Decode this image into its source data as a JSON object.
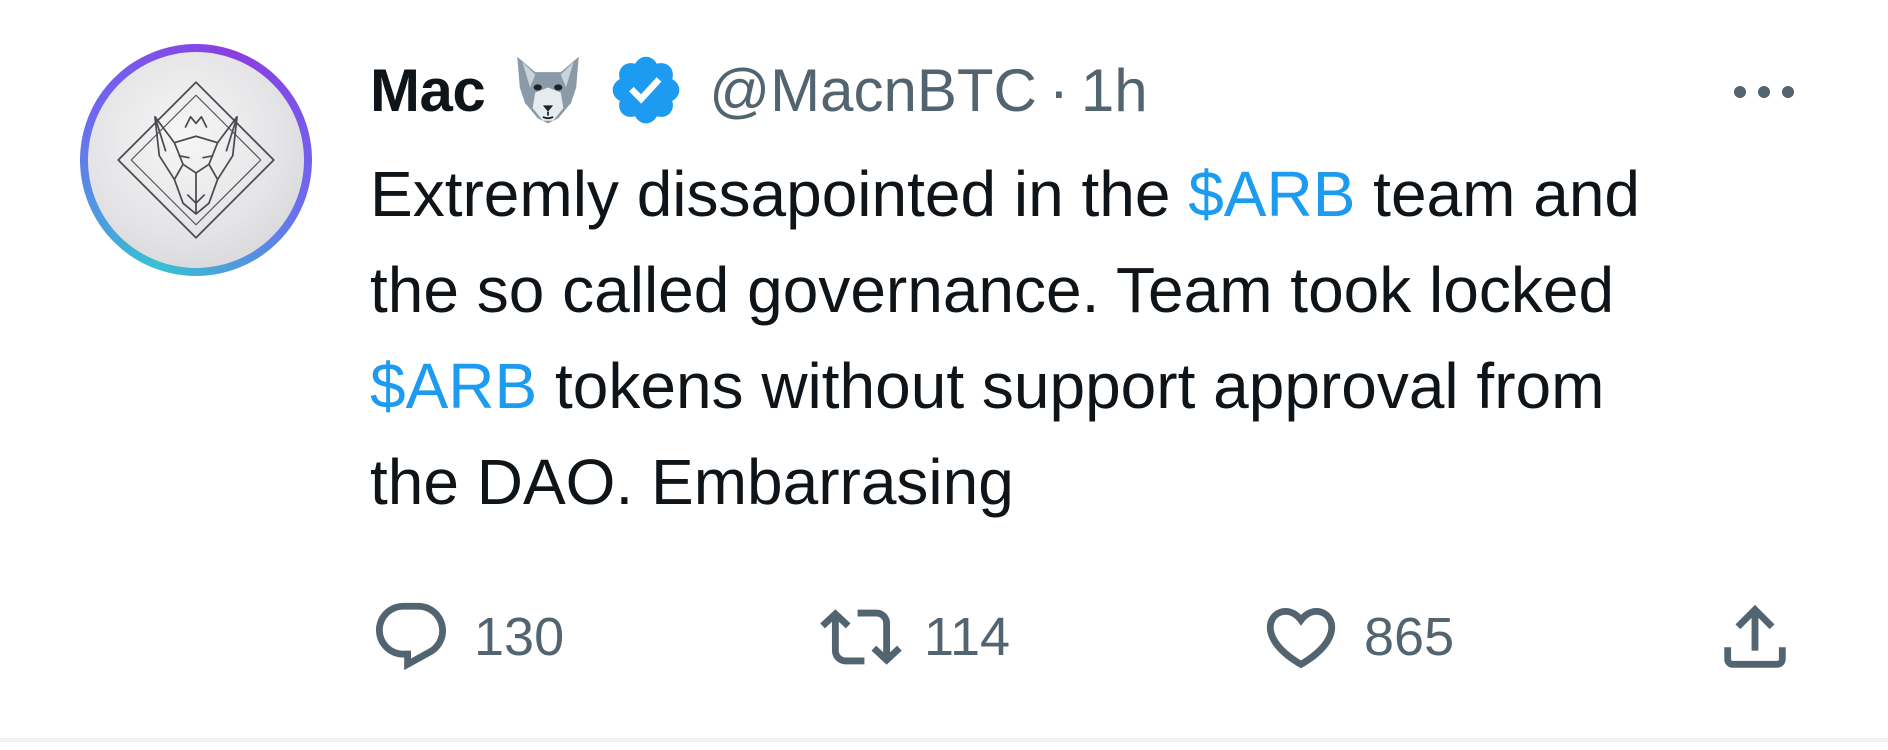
{
  "tweet": {
    "author": {
      "display_name": "Mac",
      "emoji": "wolf-emoji",
      "verified": true,
      "handle": "@MacnBTC"
    },
    "separator": "·",
    "time": "1h",
    "body_lines": [
      [
        {
          "text": "Extremly dissapointed in the ",
          "type": "text"
        },
        {
          "text": "$ARB",
          "type": "cashtag"
        },
        {
          "text": " team and",
          "type": "text"
        }
      ],
      [
        {
          "text": "the so called governance. Team took locked",
          "type": "text"
        }
      ],
      [
        {
          "text": "$ARB",
          "type": "cashtag"
        },
        {
          "text": " tokens without support approval from",
          "type": "text"
        }
      ],
      [
        {
          "text": "the DAO. Embarrasing",
          "type": "text"
        }
      ]
    ],
    "actions": {
      "reply_count": "130",
      "retweet_count": "114",
      "like_count": "865"
    }
  },
  "colors": {
    "text": "#0f1419",
    "secondary": "#536471",
    "link": "#1d9bf0",
    "divider": "#eff3f4"
  },
  "icons": [
    "more-icon",
    "reply-icon",
    "retweet-icon",
    "like-icon",
    "share-icon",
    "verified-badge-icon",
    "wolf-emoji"
  ]
}
